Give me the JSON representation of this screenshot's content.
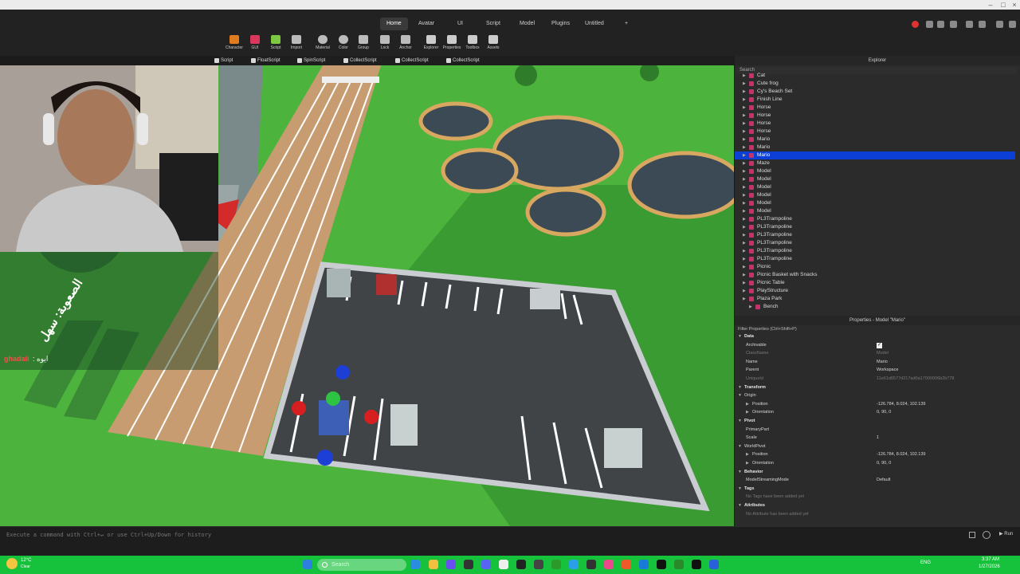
{
  "tabs": {
    "home": "Home",
    "avatar": "Avatar",
    "ui": "UI",
    "script": "Script",
    "model": "Model",
    "plugins": "Plugins",
    "untitled": "Untitled",
    "add": "+"
  },
  "toolbar": {
    "character": "Character",
    "gui": "GUI",
    "script": "Script",
    "import": "Import",
    "material": "Material",
    "color": "Color",
    "group": "Group",
    "lock": "Lock",
    "anchor": "Anchor",
    "explorer": "Explorer",
    "properties": "Properties",
    "toolbox": "Toolbox",
    "assets": "Assets"
  },
  "script_tabs": [
    {
      "label": "Script"
    },
    {
      "label": "FloatScript"
    },
    {
      "label": "SpinScript"
    },
    {
      "label": "CollectScript"
    },
    {
      "label": "CollectScript"
    },
    {
      "label": "CollectScript"
    }
  ],
  "chat": {
    "user": "ghadaii",
    "message": ": ايوه"
  },
  "signs": {
    "floor_text": "الصعوبة: سهل"
  },
  "explorer": {
    "title": "Explorer",
    "search_placeholder": "Search",
    "items": [
      {
        "label": "Cat"
      },
      {
        "label": "Cute frog"
      },
      {
        "label": "Cy's Beach Set"
      },
      {
        "label": "Finish Line"
      },
      {
        "label": "Horse"
      },
      {
        "label": "Horse"
      },
      {
        "label": "Horse"
      },
      {
        "label": "Horse"
      },
      {
        "label": "Mario"
      },
      {
        "label": "Mario"
      },
      {
        "label": "Mario"
      },
      {
        "label": "Maze"
      },
      {
        "label": "Model"
      },
      {
        "label": "Model"
      },
      {
        "label": "Model"
      },
      {
        "label": "Model"
      },
      {
        "label": "Model"
      },
      {
        "label": "Model"
      },
      {
        "label": "PL3Trampoline"
      },
      {
        "label": "PL3Trampoline"
      },
      {
        "label": "PL3Trampoline"
      },
      {
        "label": "PL3Trampoline"
      },
      {
        "label": "PL3Trampoline"
      },
      {
        "label": "PL3Trampoline"
      },
      {
        "label": "Picnic"
      },
      {
        "label": "Picnic Basket with Snacks"
      },
      {
        "label": "Picnic Table"
      },
      {
        "label": "PlayStructure"
      },
      {
        "label": "Plaza Park"
      },
      {
        "label": "Bench"
      }
    ],
    "selected_index": 10
  },
  "properties": {
    "title": "Properties - Model \"Mario\"",
    "filter_placeholder": "Filter Properties (Ctrl+Shift+P)",
    "rows": [
      {
        "type": "sec",
        "k": "Data"
      },
      {
        "type": "row",
        "k": "Archivable",
        "v": "",
        "check": true
      },
      {
        "type": "dim",
        "k": "ClassName",
        "v": "Model"
      },
      {
        "type": "row",
        "k": "Name",
        "v": "Mario"
      },
      {
        "type": "row",
        "k": "Parent",
        "v": "Workspace"
      },
      {
        "type": "dim",
        "k": "UniqueId",
        "v": "11e61d6577d217ad0a17000006b2b778"
      },
      {
        "type": "sec",
        "k": "Transform"
      },
      {
        "type": "sub",
        "k": "Origin"
      },
      {
        "type": "sub2",
        "k": "Position",
        "v": "-126.784, 8.024, 102.139"
      },
      {
        "type": "sub2",
        "k": "Orientation",
        "v": "0, 90, 0"
      },
      {
        "type": "sec",
        "k": "Pivot"
      },
      {
        "type": "row",
        "k": "PrimaryPart",
        "v": ""
      },
      {
        "type": "row",
        "k": "Scale",
        "v": "1"
      },
      {
        "type": "sub",
        "k": "WorldPivot"
      },
      {
        "type": "sub2",
        "k": "Position",
        "v": "-126.784, 8.024, 102.139"
      },
      {
        "type": "sub2",
        "k": "Orientation",
        "v": "0, 90, 0"
      },
      {
        "type": "sec",
        "k": "Behavior"
      },
      {
        "type": "row",
        "k": "ModelStreamingMode",
        "v": "Default"
      },
      {
        "type": "sec",
        "k": "Tags"
      },
      {
        "type": "dim",
        "k": "No Tags have been added yet",
        "v": ""
      },
      {
        "type": "sec",
        "k": "Attributes"
      },
      {
        "type": "dim",
        "k": "No Attribute has been added yet",
        "v": ""
      }
    ]
  },
  "command_bar": {
    "placeholder": "Execute a command with Ctrl+↵ or use Ctrl+Up/Down for history",
    "run_label": "Run"
  },
  "taskbar": {
    "weather_temp": "12°C",
    "weather_desc": "Clear",
    "search_label": "Search",
    "lang": "ENG",
    "time": "3:37 AM",
    "date": "1/27/2026"
  },
  "colors": {
    "accent_select": "#0b3fd6",
    "grass": "#49b13c",
    "taskbar": "#16c13b",
    "model_icon": "#c2336b"
  }
}
